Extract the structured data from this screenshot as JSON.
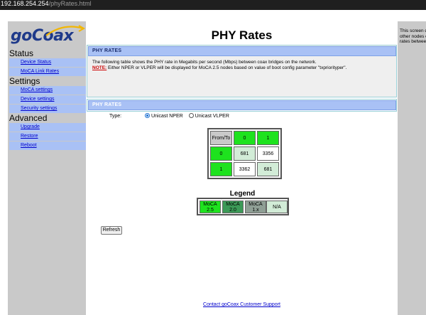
{
  "browser": {
    "url_host": "192.168.254.254",
    "url_path": "/phyRates.html"
  },
  "sidebar": {
    "logo_text": "goCoax",
    "sections": [
      {
        "title": "Status",
        "items": [
          "Device Status",
          "MoCA Link Rates"
        ]
      },
      {
        "title": "Settings",
        "items": [
          "MoCA settings",
          "Device settings",
          "Security settings"
        ]
      },
      {
        "title": "Advanced",
        "items": [
          "Upgrade",
          "Restore",
          "Reboot"
        ]
      }
    ]
  },
  "main": {
    "title": "PHY Rates",
    "panel1_header": "PHY RATES",
    "description": "The following table shows the PHY rate in Megabits per second (Mbps) between coax bridges on the network.",
    "note_label": "NOTE:",
    "note_text": " Either NPER or VLPER will be displayed for MoCA 2.5 nodes based on value of boot config parameter \"txpriorityper\".",
    "panel2_header": "PHY RATES",
    "type_label": "Type:",
    "type_options": [
      {
        "label": "Unicast NPER",
        "selected": true
      },
      {
        "label": "Unicast VLPER",
        "selected": false
      }
    ],
    "rates_table": {
      "corner": "From/To",
      "col_headers": [
        "0",
        "1"
      ],
      "rows": [
        {
          "header": "0",
          "cells": [
            "681",
            "3356"
          ]
        },
        {
          "header": "1",
          "cells": [
            "3362",
            "681"
          ]
        }
      ]
    },
    "legend_title": "Legend",
    "legend_items": [
      {
        "line1": "MoCA",
        "line2": "2.5",
        "color": "#1ee21e"
      },
      {
        "line1": "MoCA",
        "line2": "2.0",
        "color": "#3c9a57"
      },
      {
        "line1": "MoCA",
        "line2": "1.x",
        "color": "#8f9f95"
      },
      {
        "line1": "N/A",
        "line2": "",
        "color": "#d2ecd7"
      }
    ],
    "refresh_label": "Refresh"
  },
  "footer": {
    "link_text": "Contact goCoax Customer Support"
  },
  "help": {
    "text": "This screen d link status (P each coax br other nodes c network.This average of th rates betwee"
  },
  "colors": {
    "nav_bg": "#a9c1f5",
    "cell_green": "#1ee21e",
    "sidebar_bg": "#c9c9c9"
  }
}
